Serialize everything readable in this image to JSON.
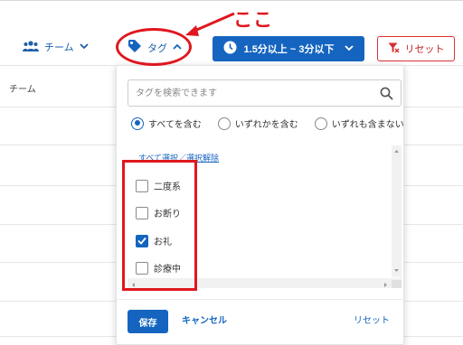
{
  "annotation": {
    "text": "ここ",
    "color": "#e0171e"
  },
  "toolbar": {
    "team_label": "チーム",
    "tag_label": "タグ",
    "range_label": "1.5分以上 ~ 3分以下",
    "reset_label": "リセット"
  },
  "table": {
    "header_team": "チーム"
  },
  "tag_panel": {
    "search_placeholder": "タグを検索できます",
    "radios": [
      {
        "label": "すべてを含む",
        "selected": true
      },
      {
        "label": "いずれかを含む",
        "selected": false
      },
      {
        "label": "いずれも含まない",
        "selected": false
      }
    ],
    "select_all_link": "すべて選択／選択解除",
    "items": [
      {
        "label": "二度系",
        "checked": false
      },
      {
        "label": "お断り",
        "checked": false
      },
      {
        "label": "お礼",
        "checked": true
      },
      {
        "label": "診療中",
        "checked": false
      }
    ],
    "save_label": "保存",
    "cancel_label": "キャンセル",
    "reset_label": "リセット"
  },
  "colors": {
    "accent": "#1565c0",
    "annotation_red": "#e0171e"
  },
  "icons": [
    "people-icon",
    "chevron-down-icon",
    "tag-icon",
    "chevron-up-icon",
    "clock-icon",
    "filter-clear-icon",
    "search-icon"
  ]
}
